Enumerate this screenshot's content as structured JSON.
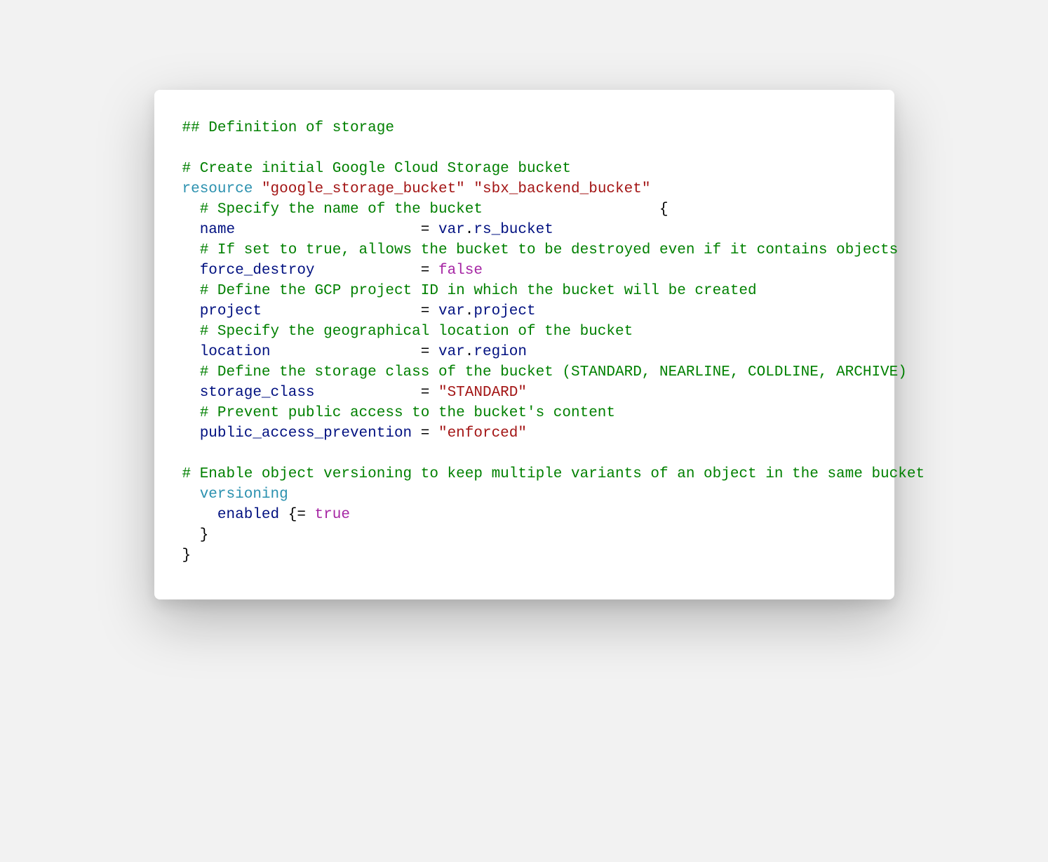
{
  "code": {
    "header": "## Definition of storage",
    "blank": " ",
    "c_create": "# Create initial Google Cloud Storage bucket",
    "res_kw": "resource",
    "res_type": "\"google_storage_bucket\"",
    "res_name": "\"sbx_backend_bucket\"",
    "c_name_pre": "  # Specify the name of the bucket                    ",
    "brace_open": "{",
    "attr_name_key": "  name                    ",
    "eq": " = ",
    "var": "var",
    "dot": ".",
    "rs_bucket": "rs_bucket",
    "c_force": "  # If set to true, allows the bucket to be destroyed even if it contains objects",
    "attr_force_key": "  force_destroy           ",
    "false": "false",
    "c_project": "  # Define the GCP project ID in which the bucket will be created",
    "attr_project_key": "  project                 ",
    "project": "project",
    "c_location": "  # Specify the geographical location of the bucket",
    "attr_location_key": "  location                ",
    "region": "region",
    "c_storage": "  # Define the storage class of the bucket (STANDARD, NEARLINE, COLDLINE, ARCHIVE)",
    "attr_storage_key": "  storage_class           ",
    "standard": "\"STANDARD\"",
    "c_public": "  # Prevent public access to the bucket's content",
    "attr_public_key": "  public_access_prevention",
    "enforced": "\"enforced\"",
    "c_versioning": "# Enable object versioning to keep multiple variants of an object in the same bucket",
    "versioning_kw": "  versioning",
    "enabled_key": "    enabled ",
    "brace_eq": "{= ",
    "true": "true",
    "close1": "  }",
    "close2": "}"
  }
}
